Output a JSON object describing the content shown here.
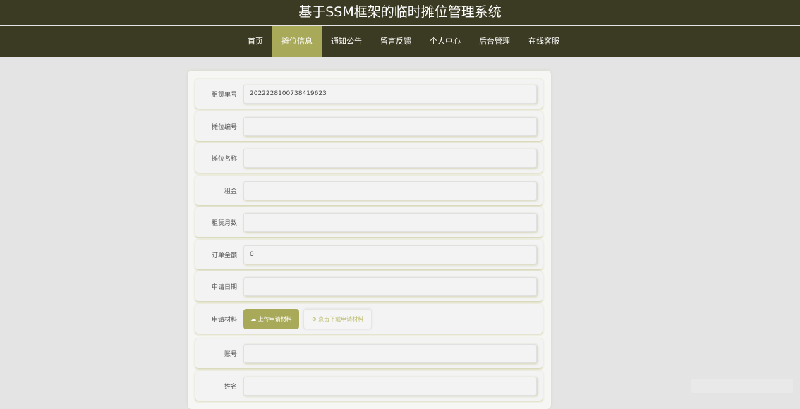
{
  "header": {
    "title": "基于SSM框架的临时摊位管理系统"
  },
  "nav": [
    "首页",
    "摊位信息",
    "通知公告",
    "留言反馈",
    "个人中心",
    "后台管理",
    "在线客服"
  ],
  "form": {
    "fields": [
      {
        "label": "租赁单号:",
        "value": "2022228100738419623"
      },
      {
        "label": "摊位编号:",
        "value": ""
      },
      {
        "label": "摊位名称:",
        "value": ""
      },
      {
        "label": "租金:",
        "value": ""
      },
      {
        "label": "租赁月数:",
        "value": ""
      },
      {
        "label": "订单金额:",
        "value": "0"
      },
      {
        "label": "申请日期:",
        "value": ""
      }
    ],
    "material": {
      "label": "申请材料:",
      "upload": "上传申请材料",
      "download": "点击下载申请材料"
    },
    "fields2": [
      {
        "label": "账号:",
        "value": ""
      },
      {
        "label": "姓名:",
        "value": ""
      }
    ]
  }
}
